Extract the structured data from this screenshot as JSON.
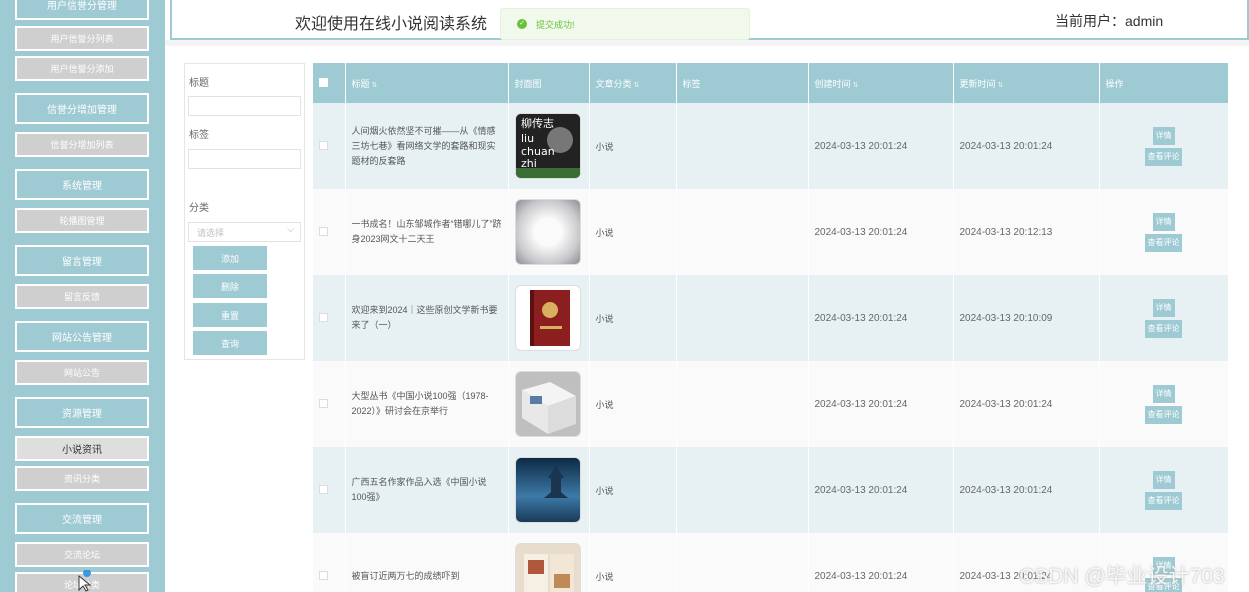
{
  "header": {
    "title": "欢迎使用在线小说阅读系统",
    "user_info": "当前用户：admin"
  },
  "toast": {
    "message": "提交成功!"
  },
  "sidebar": {
    "items": [
      {
        "label": "用户信誉分管理",
        "kind": "main"
      },
      {
        "label": "用户信誉分列表",
        "kind": "sub"
      },
      {
        "label": "用户信誉分添加",
        "kind": "sub"
      },
      {
        "label": "信誉分增加管理",
        "kind": "main"
      },
      {
        "label": "信誉分增加列表",
        "kind": "sub"
      },
      {
        "label": "系统管理",
        "kind": "main"
      },
      {
        "label": "轮播图管理",
        "kind": "sub"
      },
      {
        "label": "留言管理",
        "kind": "main"
      },
      {
        "label": "留言反馈",
        "kind": "sub"
      },
      {
        "label": "网站公告管理",
        "kind": "main"
      },
      {
        "label": "网站公告",
        "kind": "sub"
      },
      {
        "label": "资源管理",
        "kind": "main"
      },
      {
        "label": "小说资讯",
        "kind": "sub",
        "active": true
      },
      {
        "label": "资讯分类",
        "kind": "sub"
      },
      {
        "label": "交流管理",
        "kind": "main"
      },
      {
        "label": "交流论坛",
        "kind": "sub"
      },
      {
        "label": "论坛分类",
        "kind": "sub"
      }
    ]
  },
  "search": {
    "title_label": "标题",
    "tag_label": "标签",
    "category_label": "分类",
    "category_placeholder": "请选择",
    "buttons": {
      "add": "添加",
      "delete": "删除",
      "reset": "重置",
      "query": "查询"
    }
  },
  "table": {
    "headers": {
      "title": "标题",
      "cover": "封面图",
      "category": "文章分类",
      "tags": "标签",
      "created": "创建时间",
      "updated": "更新时间",
      "actions": "操作"
    },
    "action_labels": {
      "detail": "详情",
      "comments": "查看评论"
    },
    "rows": [
      {
        "title": "人间烟火依然坚不可摧——从《情感三坊七巷》看网络文学的套路和现实题材的反套路",
        "cover": "book-liuchuanzhi",
        "cover_text": {
          "cn": "柳传志",
          "en1": "liu",
          "en2": "chuan",
          "en3": "zhi"
        },
        "category": "小说",
        "tags": "",
        "created": "2024-03-13 20:01:24",
        "updated": "2024-03-13 20:01:24"
      },
      {
        "title": "一书成名！山东邹城作者“错哪儿了”跻身2023网文十二天王",
        "cover": "mist-landscape",
        "category": "小说",
        "tags": "",
        "created": "2024-03-13 20:01:24",
        "updated": "2024-03-13 20:12:13"
      },
      {
        "title": "欢迎来到2024｜这些原创文学新书要来了（一）",
        "cover": "red-book",
        "category": "小说",
        "tags": "",
        "created": "2024-03-13 20:01:24",
        "updated": "2024-03-13 20:10:09"
      },
      {
        "title": "大型丛书《中国小说100强（1978-2022）》研讨会在京举行",
        "cover": "open-book",
        "category": "小说",
        "tags": "",
        "created": "2024-03-13 20:01:24",
        "updated": "2024-03-13 20:01:24"
      },
      {
        "title": "广西五名作家作品入选《中国小说100强》",
        "cover": "blue-pagoda",
        "category": "小说",
        "tags": "",
        "created": "2024-03-13 20:01:24",
        "updated": "2024-03-13 20:01:24"
      },
      {
        "title": "被盲订近两万七的成绩吓到",
        "cover": "magazine",
        "category": "小说",
        "tags": "",
        "created": "2024-03-13 20:01:24",
        "updated": "2024-03-13 20:01:24"
      }
    ]
  },
  "watermark": "CSDN @毕业设计703",
  "colors": {
    "accent": "#9ecad3",
    "row_alt": "#e7f1f4",
    "success": "#67c23a"
  }
}
